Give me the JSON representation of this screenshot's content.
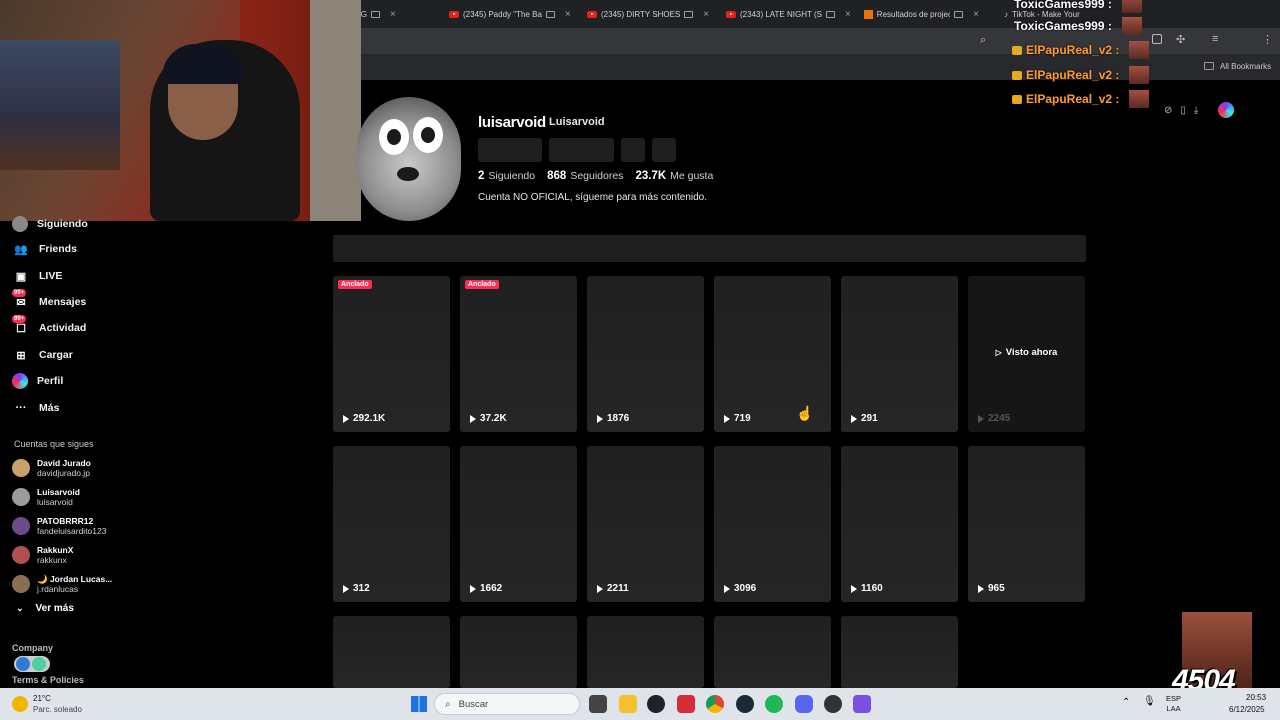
{
  "browser": {
    "tabs": [
      {
        "title": "NG",
        "type": "plain"
      },
      {
        "title": "(2345) Paddy \"The Ba",
        "type": "youtube"
      },
      {
        "title": "(2345) DIRTY SHOES",
        "type": "youtube"
      },
      {
        "title": "(2343) LATE NIGHT (S",
        "type": "youtube"
      },
      {
        "title": "Resultados de projec",
        "type": "other"
      },
      {
        "title": "TikTok - Make Your D",
        "type": "tiktok"
      }
    ],
    "bookmarks_label": "All Bookmarks"
  },
  "sidebar": {
    "nav": [
      {
        "label": "Siguiendo",
        "icon": "following-avatar-icon"
      },
      {
        "label": "Friends",
        "icon": "friends-icon"
      },
      {
        "label": "LIVE",
        "icon": "live-icon"
      },
      {
        "label": "Mensajes",
        "icon": "messages-icon",
        "badge": "99+"
      },
      {
        "label": "Actividad",
        "icon": "activity-icon",
        "badge": "99+"
      },
      {
        "label": "Cargar",
        "icon": "upload-icon"
      },
      {
        "label": "Perfil",
        "icon": "profile-icon"
      },
      {
        "label": "Más",
        "icon": "more-icon"
      }
    ],
    "following_heading": "Cuentas que sigues",
    "following": [
      {
        "name": "David Jurado",
        "handle": "davidjurado.jp",
        "color": "#c9a26a"
      },
      {
        "name": "Luisarvoid",
        "handle": "luisarvoid",
        "color": "#9c9c9c"
      },
      {
        "name": "PATOBRRR12",
        "handle": "fandeluisardito123",
        "color": "#6a4c8a"
      },
      {
        "name": "RakkunX",
        "handle": "rakkunx",
        "color": "#b05050"
      },
      {
        "name": "🌙 Jordan Lucas...",
        "handle": "j.rdanlucas",
        "color": "#8a7050"
      }
    ],
    "see_more": "Ver más",
    "company": "Company",
    "terms": "Terms & Policies"
  },
  "profile": {
    "username": "luisarvoid",
    "nickname": "Luisarvoid",
    "following_count": "2",
    "following_label": "Siguiendo",
    "followers_count": "868",
    "followers_label": "Seguidores",
    "likes_count": "23.7K",
    "likes_label": "Me gusta",
    "bio": "Cuenta NO OFICIAL, sígueme para más contenido."
  },
  "videos": [
    {
      "views": "292.1K",
      "pinned": "Anclado"
    },
    {
      "views": "37.2K",
      "pinned": "Anclado"
    },
    {
      "views": "1876"
    },
    {
      "views": "719"
    },
    {
      "views": "291"
    },
    {
      "views": "2245",
      "watched": "Visto ahora"
    },
    {
      "views": "312"
    },
    {
      "views": "1662"
    },
    {
      "views": "2211"
    },
    {
      "views": "3096"
    },
    {
      "views": "1160"
    },
    {
      "views": "965"
    },
    {
      "views": ""
    },
    {
      "views": ""
    },
    {
      "views": ""
    },
    {
      "views": ""
    },
    {
      "views": ""
    }
  ],
  "chat": [
    {
      "name": "ToxicGames999 :",
      "kind": "toxic"
    },
    {
      "name": "ToxicGames999 :",
      "kind": "toxic"
    },
    {
      "name": "ElPapuReal_v2 :",
      "kind": "papu"
    },
    {
      "name": "ElPapuReal_v2 :",
      "kind": "papu"
    },
    {
      "name": "ElPapuReal_v2 :",
      "kind": "papu"
    }
  ],
  "overlay": {
    "meme_number": "4504"
  },
  "taskbar": {
    "weather_temp": "21°C",
    "weather_desc": "Parc. soleado",
    "search_placeholder": "Buscar",
    "lang_top": "ESP",
    "lang_bottom": "LAA",
    "time": "20:53",
    "date": "6/12/2025"
  }
}
